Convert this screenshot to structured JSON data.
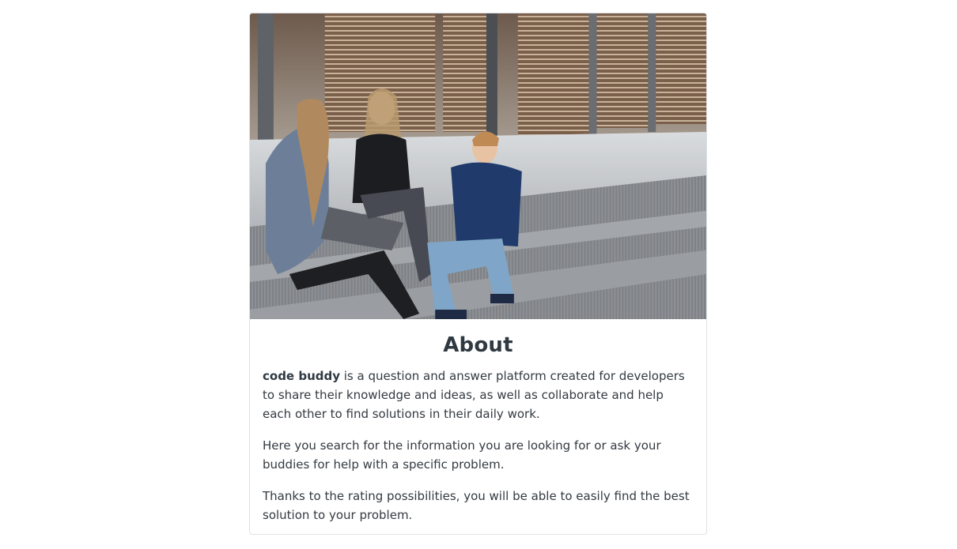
{
  "hero_image": {
    "alt": "Three young people sitting on outdoor concrete steps with a laptop, talking and smiling",
    "icon": "photo-image"
  },
  "about": {
    "title": "About",
    "brand": "code buddy",
    "paragraph1_rest": " is a question and answer platform created for developers to share their knowledge and ideas, as well as collaborate and help each other to find solutions in their daily work.",
    "paragraph2": "Here you search for the information you are looking for or ask your buddies for help with a specific problem.",
    "paragraph3": "Thanks to the rating possibilities, you will be able to easily find the best solution to your problem."
  },
  "colors": {
    "text": "#343a40",
    "border": "#dfe1e4",
    "background": "#ffffff"
  }
}
